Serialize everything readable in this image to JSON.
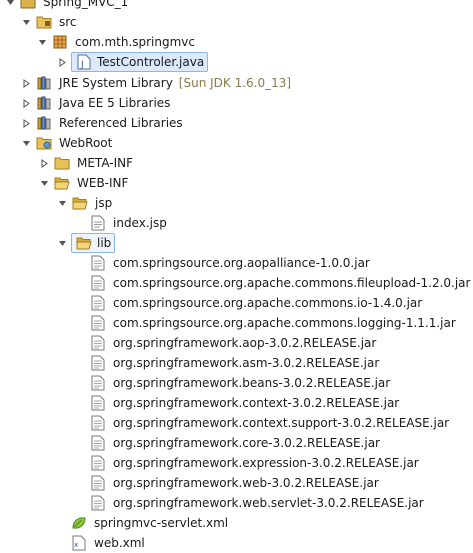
{
  "project": {
    "name": "Spring_MVC_1"
  },
  "src": {
    "label": "src"
  },
  "package": {
    "label": "com.mth.springmvc"
  },
  "java_file": {
    "label": "TestControler.java"
  },
  "jre": {
    "label": "JRE System Library",
    "decoration": "[Sun JDK 1.6.0_13]"
  },
  "javaee": {
    "label": "Java EE 5 Libraries"
  },
  "reflibs": {
    "label": "Referenced Libraries"
  },
  "webroot": {
    "label": "WebRoot"
  },
  "metainf": {
    "label": "META-INF"
  },
  "webinf": {
    "label": "WEB-INF"
  },
  "jsp_folder": {
    "label": "jsp"
  },
  "index_jsp": {
    "label": "index.jsp"
  },
  "lib_folder": {
    "label": "lib"
  },
  "jars": [
    "com.springsource.org.aopalliance-1.0.0.jar",
    "com.springsource.org.apache.commons.fileupload-1.2.0.jar",
    "com.springsource.org.apache.commons.io-1.4.0.jar",
    "com.springsource.org.apache.commons.logging-1.1.1.jar",
    "org.springframework.aop-3.0.2.RELEASE.jar",
    "org.springframework.asm-3.0.2.RELEASE.jar",
    "org.springframework.beans-3.0.2.RELEASE.jar",
    "org.springframework.context-3.0.2.RELEASE.jar",
    "org.springframework.context.support-3.0.2.RELEASE.jar",
    "org.springframework.core-3.0.2.RELEASE.jar",
    "org.springframework.expression-3.0.2.RELEASE.jar",
    "org.springframework.web-3.0.2.RELEASE.jar",
    "org.springframework.web.servlet-3.0.2.RELEASE.jar"
  ],
  "servlet_xml": {
    "label": "springmvc-servlet.xml"
  },
  "web_xml": {
    "label": "web.xml"
  },
  "colors": {
    "selection_bg": "#dbe9fb",
    "selection_border": "#8fb4e8",
    "decoration": "#8d7a4c",
    "folder": "#e8c15a"
  }
}
